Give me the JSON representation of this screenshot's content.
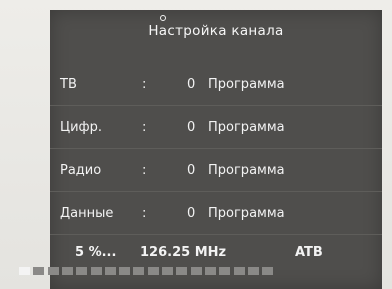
{
  "title": "Настройка канала",
  "rows": [
    {
      "label": "ТВ",
      "separator": ":",
      "count": "0",
      "unit": "Программа"
    },
    {
      "label": "Цифр.",
      "separator": ":",
      "count": "0",
      "unit": "Программа"
    },
    {
      "label": "Радио",
      "separator": ":",
      "count": "0",
      "unit": "Программа"
    },
    {
      "label": "Данные",
      "separator": ":",
      "count": "0",
      "unit": "Программа"
    }
  ],
  "status": {
    "percent": "5 %...",
    "frequency": "126.25 MHz",
    "standard": "ATB"
  },
  "progress": {
    "total_segments": 18,
    "filled_segments": 1
  },
  "colors": {
    "panel": "#4f4e4c",
    "text": "#f3f3f3",
    "progress_filled": "#f4f4f4",
    "progress_empty": "#8a8987"
  }
}
